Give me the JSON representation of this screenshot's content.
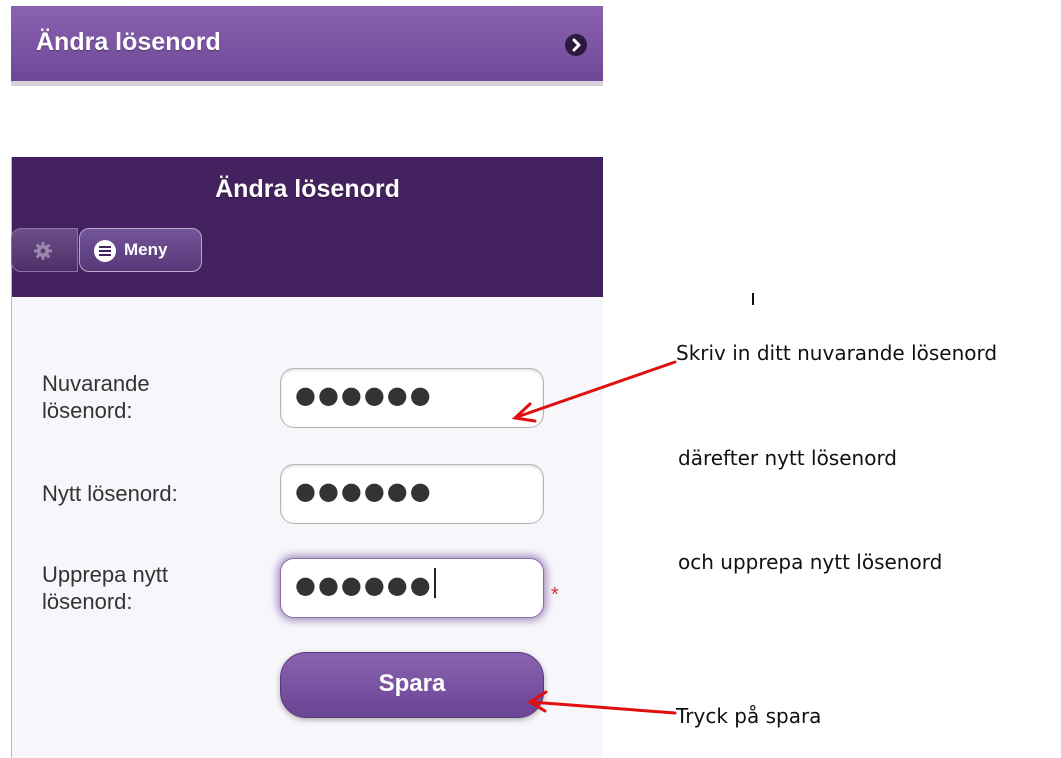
{
  "menu_item": {
    "label": "Ändra lösenord"
  },
  "header": {
    "title": "Ändra lösenord",
    "menu_label": "Meny"
  },
  "form": {
    "fields": [
      {
        "label_line1": "Nuvarande",
        "label_line2": "lösenord:",
        "value": "●●●●●●"
      },
      {
        "label_line1": "Nytt lösenord:",
        "label_line2": "",
        "value": "●●●●●●"
      },
      {
        "label_line1": "Upprepa nytt",
        "label_line2": "lösenord:",
        "value": "●●●●●●"
      }
    ],
    "required_marker": "*",
    "save_label": "Spara"
  },
  "annotations": {
    "current": "Skriv in ditt nuvarande lösenord",
    "new": "därefter nytt lösenord",
    "repeat": "och upprepa nytt lösenord",
    "save": "Tryck på spara"
  },
  "colors": {
    "accent": "#7a55a3",
    "header_bg": "#43225f",
    "arrow": "#e01010"
  }
}
